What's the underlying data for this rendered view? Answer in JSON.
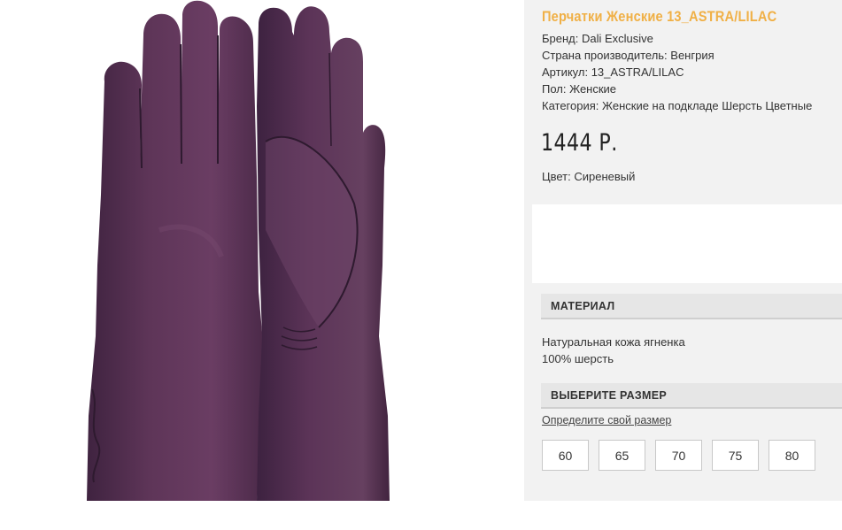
{
  "product": {
    "title": "Перчатки Женские 13_ASTRA/LILAC",
    "specs": {
      "brand": "Бренд: Dali Exclusive",
      "country": "Страна производитель: Венгрия",
      "article": "Артикул: 13_ASTRA/LILAC",
      "gender": "Пол: Женские",
      "category": "Категория: Женские на подкладе Шерсть Цветные"
    },
    "price": "1444 Р.",
    "color": "Цвет: Сиреневый",
    "image_icon": "gloves-photo",
    "glove_color": "#5b3457"
  },
  "material": {
    "header": "МАТЕРИАЛ",
    "line1": "Натуральная кожа ягненка",
    "line2": "100% шерсть"
  },
  "size": {
    "header": "ВЫБЕРИТЕ РАЗМЕР",
    "link": "Определите свой размер",
    "options": [
      "60",
      "65",
      "70",
      "75",
      "80"
    ]
  },
  "colors": {
    "accent_title": "#f0b046",
    "panel_bg": "#f2f2f2"
  }
}
